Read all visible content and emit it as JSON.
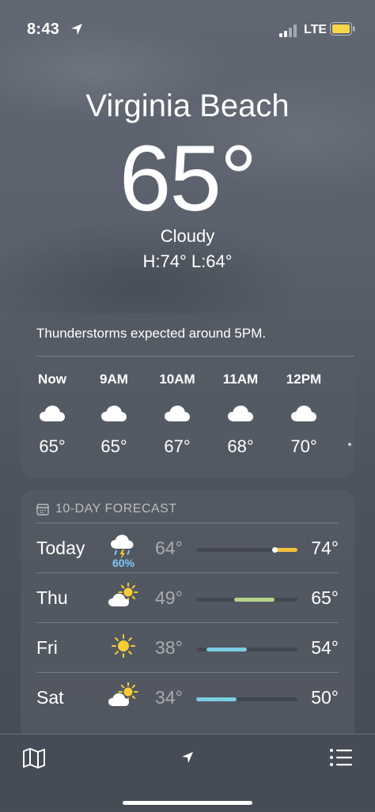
{
  "status_bar": {
    "time": "8:43",
    "network": "LTE",
    "battery_color": "#f7d54a"
  },
  "location": {
    "city": "Virginia Beach",
    "temperature": "65°",
    "condition": "Cloudy",
    "high_low": "H:74°  L:64°"
  },
  "hourly": {
    "alert": "Thunderstorms expected around 5PM.",
    "items": [
      {
        "time": "Now",
        "icon": "cloud-icon",
        "temp": "65°"
      },
      {
        "time": "9AM",
        "icon": "cloud-icon",
        "temp": "65°"
      },
      {
        "time": "10AM",
        "icon": "cloud-icon",
        "temp": "67°"
      },
      {
        "time": "11AM",
        "icon": "cloud-icon",
        "temp": "68°"
      },
      {
        "time": "12PM",
        "icon": "cloud-icon",
        "temp": "70°"
      }
    ]
  },
  "daily": {
    "header": "10-DAY FORECAST",
    "range_min": 34,
    "range_max": 74,
    "days": [
      {
        "day": "Today",
        "icon": "thunderstorm-icon",
        "precip": "60%",
        "low": "64°",
        "high": "74°",
        "low_val": 64,
        "high_val": 74,
        "current_val": 65,
        "color": "#f2c23a"
      },
      {
        "day": "Thu",
        "icon": "partly-sunny-icon",
        "low": "49°",
        "high": "65°",
        "low_val": 49,
        "high_val": 65,
        "color": "#b5d38f"
      },
      {
        "day": "Fri",
        "icon": "sun-icon",
        "low": "38°",
        "high": "54°",
        "low_val": 38,
        "high_val": 54,
        "color": "#78cde0"
      },
      {
        "day": "Sat",
        "icon": "partly-sunny-icon",
        "low": "34°",
        "high": "50°",
        "low_val": 34,
        "high_val": 50,
        "color": "#78cde0"
      }
    ]
  },
  "toolbar": {
    "map": "map-icon",
    "location": "location-arrow-icon",
    "list": "list-icon"
  }
}
